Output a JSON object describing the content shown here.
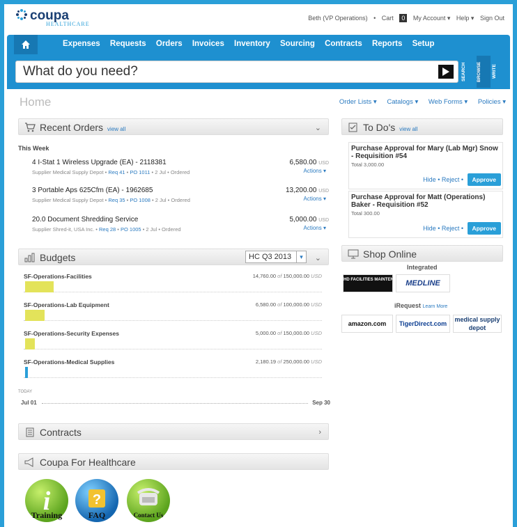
{
  "app": {
    "logo_text": "coupa",
    "logo_sub": "HEALTHCARE"
  },
  "toplinks": {
    "user": "Beth (VP Operations)",
    "cart": "Cart",
    "cart_count": "0",
    "account": "My Account ▾",
    "help": "Help ▾",
    "signout": "Sign Out"
  },
  "nav": {
    "items": [
      "Expenses",
      "Requests",
      "Orders",
      "Invoices",
      "Inventory",
      "Sourcing",
      "Contracts",
      "Reports",
      "Setup"
    ]
  },
  "search": {
    "placeholder": "What do you need?",
    "tabs": [
      "SEARCH",
      "BROWSE",
      "WRITE"
    ]
  },
  "home": {
    "title": "Home",
    "menus": [
      "Order Lists ▾",
      "Catalogs ▾",
      "Web Forms ▾",
      "Policies ▾"
    ]
  },
  "recent_orders": {
    "title": "Recent Orders",
    "view_all": "view all",
    "period": "This Week",
    "orders": [
      {
        "name": "4 I-Stat 1 Wireless Upgrade (EA) - 2118381",
        "supplier": "Supplier Medical Supply Depot",
        "req": "Req 41",
        "po": "PO 1011",
        "date": "2 Jul",
        "status": "Ordered",
        "amount": "6,580.00",
        "currency": "USD",
        "actions": "Actions ▾"
      },
      {
        "name": "3 Portable Aps 625Cfm (EA) - 1962685",
        "supplier": "Supplier Medical Supply Depot",
        "req": "Req 35",
        "po": "PO 1008",
        "date": "2 Jul",
        "status": "Ordered",
        "amount": "13,200.00",
        "currency": "USD",
        "actions": "Actions ▾"
      },
      {
        "name": "20.0 Document Shredding Service",
        "supplier": "Supplier Shred-it, USA Inc.",
        "req": "Req 28",
        "po": "PO 1005",
        "date": "2 Jul",
        "status": "Ordered",
        "amount": "5,000.00",
        "currency": "USD",
        "actions": "Actions ▾"
      }
    ]
  },
  "budgets": {
    "title": "Budgets",
    "period": "HC Q3 2013",
    "items": [
      {
        "name": "SF-Operations-Facilities",
        "spent": "14,760.00",
        "of": "of",
        "total": "150,000.00",
        "currency": "USD",
        "fraction": 0.098,
        "color": "#e3e35a"
      },
      {
        "name": "SF-Operations-Lab Equipment",
        "spent": "6,580.00",
        "of": "of",
        "total": "100,000.00",
        "currency": "USD",
        "fraction": 0.066,
        "color": "#e3e35a"
      },
      {
        "name": "SF-Operations-Security Expenses",
        "spent": "5,000.00",
        "of": "of",
        "total": "150,000.00",
        "currency": "USD",
        "fraction": 0.033,
        "color": "#e3e35a"
      },
      {
        "name": "SF-Operations-Medical Supplies",
        "spent": "2,180.19",
        "of": "of",
        "total": "250,000.00",
        "currency": "USD",
        "fraction": 0.009,
        "color": "#2a9fd8"
      }
    ],
    "today": "TODAY",
    "start": "Jul 01",
    "end": "Sep 30"
  },
  "contracts": {
    "title": "Contracts"
  },
  "healthcare": {
    "title": "Coupa For Healthcare",
    "links": [
      "Training",
      "FAQ",
      "Contact Us"
    ]
  },
  "todos": {
    "title": "To Do's",
    "view_all": "view all",
    "items": [
      {
        "title": "Purchase Approval for Mary (Lab Mgr) Snow - Requisition #54",
        "total": "Total 3,000.00",
        "hide": "Hide",
        "reject": "Reject",
        "approve": "Approve"
      },
      {
        "title": "Purchase Approval for Matt (Operations) Baker - Requisition #52",
        "total": "Total 300.00",
        "hide": "Hide",
        "reject": "Reject",
        "approve": "Approve"
      }
    ]
  },
  "shop": {
    "title": "Shop Online",
    "integrated_label": "Integrated",
    "integrated": [
      "HD FACILITIES MAINTENANCE",
      "MEDLINE"
    ],
    "irequest_label": "iRequest",
    "learn_more": "Learn More",
    "irequest": [
      "amazon.com",
      "TigerDirect.com",
      "medical supply depot"
    ]
  },
  "colors": {
    "accent": "#1e90d0",
    "link": "#2a7ac0",
    "budget_fill": "#e3e35a",
    "approve": "#2a9fd8"
  }
}
